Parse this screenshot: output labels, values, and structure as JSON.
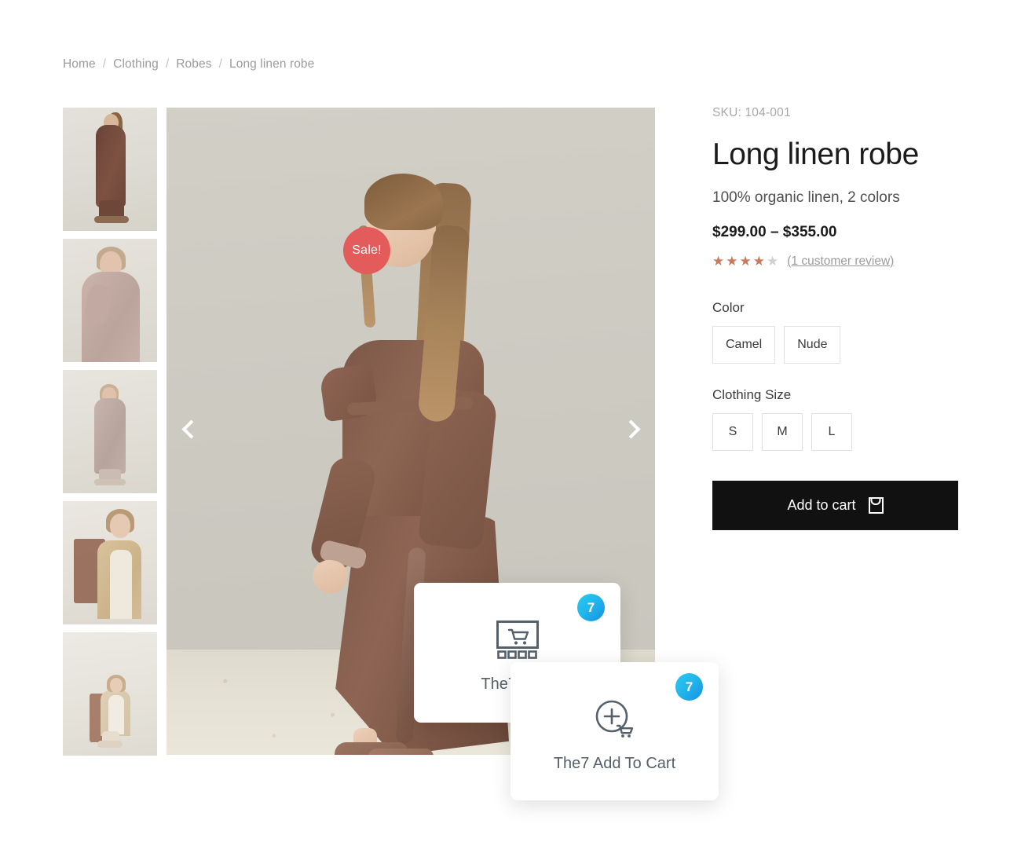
{
  "breadcrumb": {
    "items": [
      "Home",
      "Clothing",
      "Robes",
      "Long linen robe"
    ],
    "separator": "/"
  },
  "gallery": {
    "sale_badge": "Sale!",
    "prev_label": "Previous image",
    "next_label": "Next image",
    "thumb_count": 5,
    "thumbnails": [
      "Model walking in dark brown linen robe",
      "Close-up of model in dusty rose linen robe",
      "Model walking in mauve long linen robe",
      "Model seated wearing camel cardigan over cream slip",
      "Model seated full length in pale linen robe"
    ]
  },
  "product": {
    "sku_label": "SKU: 104-001",
    "title": "Long linen robe",
    "subtitle": "100% organic linen, 2 colors",
    "price": "$299.00 – $355.00",
    "rating": 4,
    "rating_max": 5,
    "review_count_text": "(1 customer review)",
    "star_filled_color": "#c9795d",
    "star_empty_color": "#d0d0d0",
    "sale_badge_color": "#e35b5b"
  },
  "attributes": [
    {
      "label": "Color",
      "options": [
        "Camel",
        "Nude"
      ],
      "style": "wide"
    },
    {
      "label": "Clothing Size",
      "options": [
        "S",
        "M",
        "L"
      ],
      "style": "square"
    }
  ],
  "cart": {
    "button_label": "Add to cart",
    "button_icon": "shopping-bag-icon",
    "button_color": "#111111"
  },
  "plugin_cards": [
    {
      "label": "The7 Proc",
      "badge": "7",
      "icon": "products-grid-cart-icon"
    },
    {
      "label": "The7 Add To Cart",
      "badge": "7",
      "icon": "add-to-cart-plus-icon"
    }
  ],
  "colors": {
    "badge_gradient_start": "#26c9f0",
    "badge_gradient_end": "#178fe3",
    "page_background": "#ffffff"
  }
}
